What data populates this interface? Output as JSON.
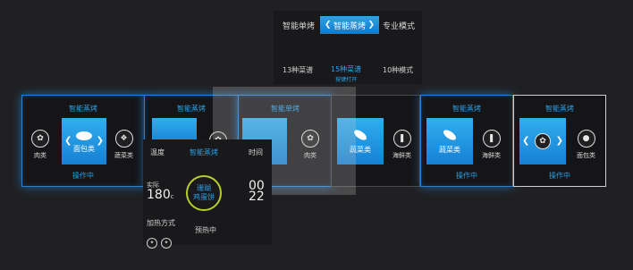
{
  "mode_bar": {
    "left": "智能单烤",
    "active": "智能蒸烤",
    "right": "专业模式",
    "sub_left": "13种菜谱",
    "sub_active": "15种菜谱",
    "sub_hint": "按键打开",
    "sub_right": "10种模式"
  },
  "panels": {
    "p1": {
      "title": "智能蒸烤",
      "left": "肉类",
      "center": "面包类",
      "right": "蔬菜类",
      "status": "操作中"
    },
    "p2": {
      "title": "智能蒸烤"
    },
    "p3": {
      "title": "智能单烤",
      "right": "肉类"
    },
    "p4": {
      "center": "蔬菜类",
      "right": "海鲜类"
    },
    "p5": {
      "title": "智能蒸烤",
      "center": "蔬菜类",
      "right": "海鲜类",
      "status": "操作中"
    },
    "p6": {
      "title": "智能蒸烤",
      "right": "面包类",
      "status": "操作中"
    }
  },
  "detail": {
    "temp_label": "温度",
    "mode": "智能蒸烤",
    "time_label": "时间",
    "actual_label": "实际",
    "temp_value": "180",
    "temp_unit": "c",
    "ring_line1": "珊瑚",
    "ring_line2": "鸡蛋饼",
    "time_value1": "00",
    "time_value2": "22",
    "heating_label": "加热方式",
    "status": "预热中"
  },
  "colors": {
    "accent": "#2a9ee6",
    "tile": "#1f8fe0",
    "ring": "#b8cc2a"
  }
}
